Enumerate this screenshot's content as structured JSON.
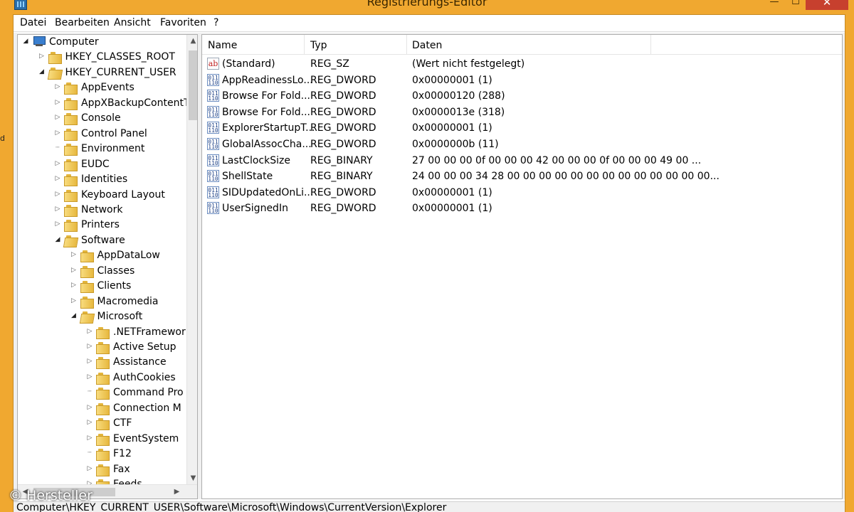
{
  "window": {
    "title": "Registrierungs-Editor",
    "minimize_glyph": "—",
    "maximize_glyph": "☐",
    "close_glyph": "✕",
    "edge_text": "d"
  },
  "menu": {
    "items": [
      "Datei",
      "Bearbeiten",
      "Ansicht",
      "Favoriten",
      "?"
    ]
  },
  "tree": {
    "items": [
      {
        "label": "Computer",
        "icon": "computer-icon",
        "expander": "expanded"
      },
      {
        "label": "HKEY_CLASSES_ROOT",
        "icon": "folder-icon",
        "expander": "collapsed"
      },
      {
        "label": "HKEY_CURRENT_USER",
        "icon": "folder-icon",
        "expander": "expanded"
      },
      {
        "label": "AppEvents",
        "icon": "folder-icon",
        "expander": "collapsed"
      },
      {
        "label": "AppXBackupContentT",
        "icon": "folder-icon",
        "expander": "collapsed"
      },
      {
        "label": "Console",
        "icon": "folder-icon",
        "expander": "collapsed"
      },
      {
        "label": "Control Panel",
        "icon": "folder-icon",
        "expander": "collapsed"
      },
      {
        "label": "Environment",
        "icon": "folder-icon",
        "expander": "none"
      },
      {
        "label": "EUDC",
        "icon": "folder-icon",
        "expander": "collapsed"
      },
      {
        "label": "Identities",
        "icon": "folder-icon",
        "expander": "collapsed"
      },
      {
        "label": "Keyboard Layout",
        "icon": "folder-icon",
        "expander": "collapsed"
      },
      {
        "label": "Network",
        "icon": "folder-icon",
        "expander": "collapsed"
      },
      {
        "label": "Printers",
        "icon": "folder-icon",
        "expander": "collapsed"
      },
      {
        "label": "Software",
        "icon": "folder-icon",
        "expander": "expanded"
      },
      {
        "label": "AppDataLow",
        "icon": "folder-icon",
        "expander": "collapsed"
      },
      {
        "label": "Classes",
        "icon": "folder-icon",
        "expander": "collapsed"
      },
      {
        "label": "Clients",
        "icon": "folder-icon",
        "expander": "collapsed"
      },
      {
        "label": "Macromedia",
        "icon": "folder-icon",
        "expander": "collapsed"
      },
      {
        "label": "Microsoft",
        "icon": "folder-icon",
        "expander": "expanded"
      },
      {
        "label": ".NETFramewor",
        "icon": "folder-icon",
        "expander": "collapsed"
      },
      {
        "label": "Active Setup",
        "icon": "folder-icon",
        "expander": "collapsed"
      },
      {
        "label": "Assistance",
        "icon": "folder-icon",
        "expander": "collapsed"
      },
      {
        "label": "AuthCookies",
        "icon": "folder-icon",
        "expander": "collapsed"
      },
      {
        "label": "Command Pro",
        "icon": "folder-icon",
        "expander": "none"
      },
      {
        "label": "Connection M",
        "icon": "folder-icon",
        "expander": "collapsed"
      },
      {
        "label": "CTF",
        "icon": "folder-icon",
        "expander": "collapsed"
      },
      {
        "label": "EventSystem",
        "icon": "folder-icon",
        "expander": "collapsed"
      },
      {
        "label": "F12",
        "icon": "folder-icon",
        "expander": "none"
      },
      {
        "label": "Fax",
        "icon": "folder-icon",
        "expander": "collapsed"
      },
      {
        "label": "Feeds",
        "icon": "folder-icon",
        "expander": "collapsed"
      }
    ]
  },
  "scroll": {
    "up": "▲",
    "down": "▼",
    "left": "◀",
    "right": "▶"
  },
  "list": {
    "columns": [
      "Name",
      "Typ",
      "Daten"
    ],
    "rows": [
      {
        "icon": "ab",
        "name": "(Standard)",
        "type": "REG_SZ",
        "data": "(Wert nicht festgelegt)"
      },
      {
        "icon": "bin",
        "name": "AppReadinessLo...",
        "type": "REG_DWORD",
        "data": "0x00000001 (1)"
      },
      {
        "icon": "bin",
        "name": "Browse For Fold...",
        "type": "REG_DWORD",
        "data": "0x00000120 (288)"
      },
      {
        "icon": "bin",
        "name": "Browse For Fold...",
        "type": "REG_DWORD",
        "data": "0x0000013e (318)"
      },
      {
        "icon": "bin",
        "name": "ExplorerStartupT...",
        "type": "REG_DWORD",
        "data": "0x00000001 (1)"
      },
      {
        "icon": "bin",
        "name": "GlobalAssocCha...",
        "type": "REG_DWORD",
        "data": "0x0000000b (11)"
      },
      {
        "icon": "bin",
        "name": "LastClockSize",
        "type": "REG_BINARY",
        "data": "27 00 00 00 0f 00 00 00 42 00 00 00 0f 00 00 00 49 00 ..."
      },
      {
        "icon": "bin",
        "name": "ShellState",
        "type": "REG_BINARY",
        "data": "24 00 00 00 34 28 00 00 00 00 00 00 00 00 00 00 00 00 00..."
      },
      {
        "icon": "bin",
        "name": "SIDUpdatedOnLi...",
        "type": "REG_DWORD",
        "data": "0x00000001 (1)"
      },
      {
        "icon": "bin",
        "name": "UserSignedIn",
        "type": "REG_DWORD",
        "data": "0x00000001 (1)"
      }
    ]
  },
  "status": {
    "path": "Computer\\HKEY_CURRENT_USER\\Software\\Microsoft\\Windows\\CurrentVersion\\Explorer"
  },
  "watermark": "© Hersteller",
  "colors": {
    "desktop_accent": "#f0a830",
    "close_button": "#c7402e"
  }
}
